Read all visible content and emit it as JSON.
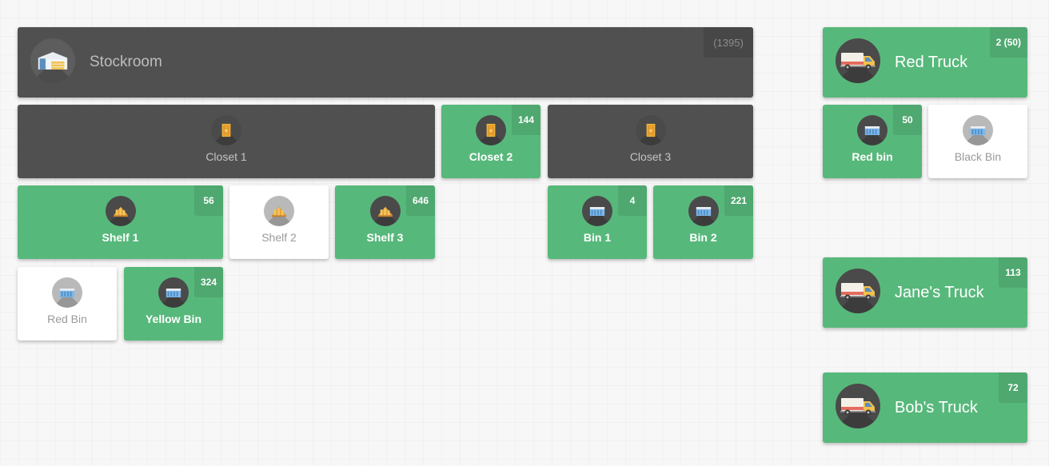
{
  "stockroom": {
    "label": "Stockroom",
    "count": "(1395)",
    "icon": "warehouse-icon",
    "state": "dark"
  },
  "closets": [
    {
      "label": "Closet 1",
      "count": "",
      "icon": "closet-icon",
      "state": "dark"
    },
    {
      "label": "Closet 2",
      "count": "144",
      "icon": "closet-icon",
      "state": "green"
    },
    {
      "label": "Closet 3",
      "count": "",
      "icon": "closet-icon",
      "state": "dark"
    }
  ],
  "shelves": [
    {
      "label": "Shelf 1",
      "count": "56",
      "icon": "shelf-icon",
      "state": "green"
    },
    {
      "label": "Shelf 2",
      "count": "",
      "icon": "shelf-icon",
      "state": "white"
    },
    {
      "label": "Shelf 3",
      "count": "646",
      "icon": "shelf-icon",
      "state": "green"
    }
  ],
  "bins": [
    {
      "label": "Bin 1",
      "count": "4",
      "icon": "bin-icon",
      "state": "green"
    },
    {
      "label": "Bin 2",
      "count": "221",
      "icon": "bin-icon",
      "state": "green"
    },
    {
      "label": "Red Bin",
      "count": "",
      "icon": "bin-icon",
      "state": "white"
    },
    {
      "label": "Yellow Bin",
      "count": "324",
      "icon": "bin-icon",
      "state": "green"
    }
  ],
  "trucks": [
    {
      "label": "Red Truck",
      "count": "2 (50)",
      "icon": "truck-icon",
      "state": "green"
    },
    {
      "label": "Jane's Truck",
      "count": "113",
      "icon": "truck-icon",
      "state": "green"
    },
    {
      "label": "Bob's Truck",
      "count": "72",
      "icon": "truck-icon",
      "state": "green"
    }
  ],
  "truck_bins": [
    {
      "label": "Red bin",
      "count": "50",
      "icon": "bin-icon",
      "state": "green"
    },
    {
      "label": "Black Bin",
      "count": "",
      "icon": "bin-icon",
      "state": "white"
    }
  ],
  "colors": {
    "green": "#57b87b",
    "dark": "#505050",
    "white": "#ffffff"
  }
}
